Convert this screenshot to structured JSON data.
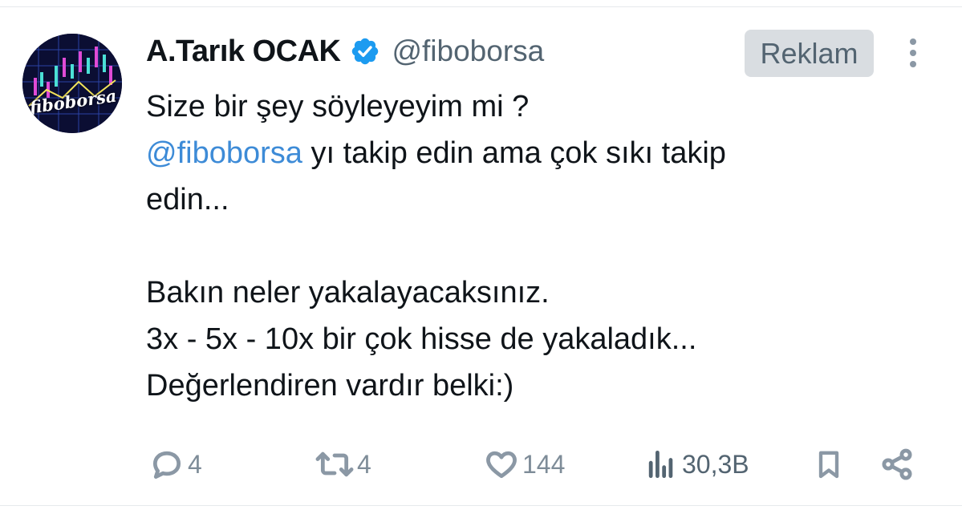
{
  "tweet": {
    "author": {
      "display_name": "A.Tarık OCAK",
      "handle": "@fiboborsa",
      "verified": true,
      "avatar_text": "fiboborsa"
    },
    "ad_label": "Reklam",
    "text": {
      "line1": "Size bir şey söyleyeyim mi ?",
      "mention": "@fiboborsa",
      "line2_rest": " yı takip edin ama çok sıkı takip",
      "line3": "edin...",
      "line4": "Bakın neler yakalayacaksınız.",
      "line5": "3x - 5x - 10x  bir çok hisse de yakaladık...",
      "line6": "Değerlendiren vardır belki:)"
    },
    "stats": {
      "replies": "4",
      "reposts": "4",
      "likes": "144",
      "views": "30,3B"
    }
  },
  "colors": {
    "mention": "#3d8bd7",
    "verified_badge": "#1d9bf0",
    "muted": "#536471",
    "ad_badge_bg": "#d9dde1"
  },
  "icons": [
    "verified-badge-icon",
    "more-options-icon",
    "reply-icon",
    "repost-icon",
    "like-icon",
    "views-icon",
    "bookmark-icon",
    "share-icon"
  ]
}
